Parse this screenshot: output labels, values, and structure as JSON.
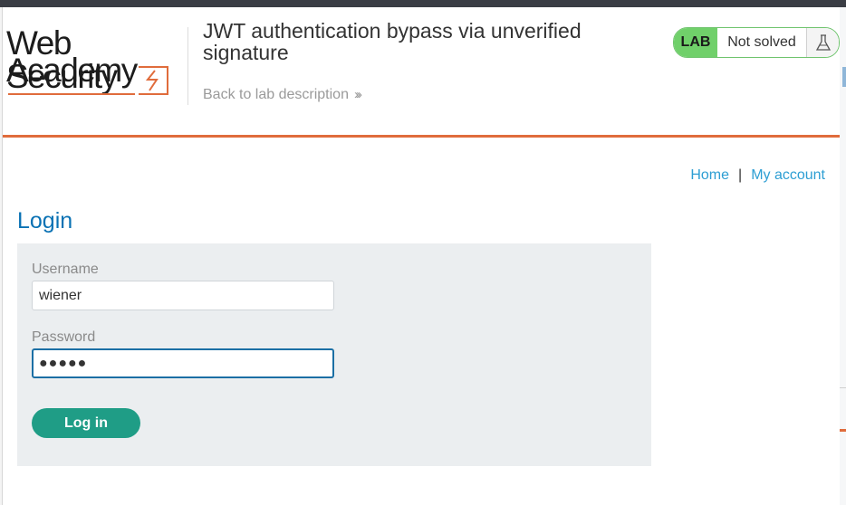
{
  "logo": {
    "line1": "Web Security",
    "line2": "Academy"
  },
  "lab": {
    "title": "JWT authentication bypass via unverified signature",
    "back_link": "Back to lab description",
    "badge_tag": "LAB",
    "status": "Not solved",
    "status_icon": "flask-icon"
  },
  "nav": {
    "home": "Home",
    "separator": "|",
    "account": "My account"
  },
  "page": {
    "title": "Login"
  },
  "form": {
    "username_label": "Username",
    "username_value": "wiener",
    "password_label": "Password",
    "password_value": "●●●●●",
    "submit_label": "Log in"
  },
  "colors": {
    "accent": "#e06c3c",
    "title_blue": "#0a72b4",
    "link_blue": "#2d9ed3",
    "button_green": "#1f9d86",
    "lab_green": "#70d06a"
  }
}
